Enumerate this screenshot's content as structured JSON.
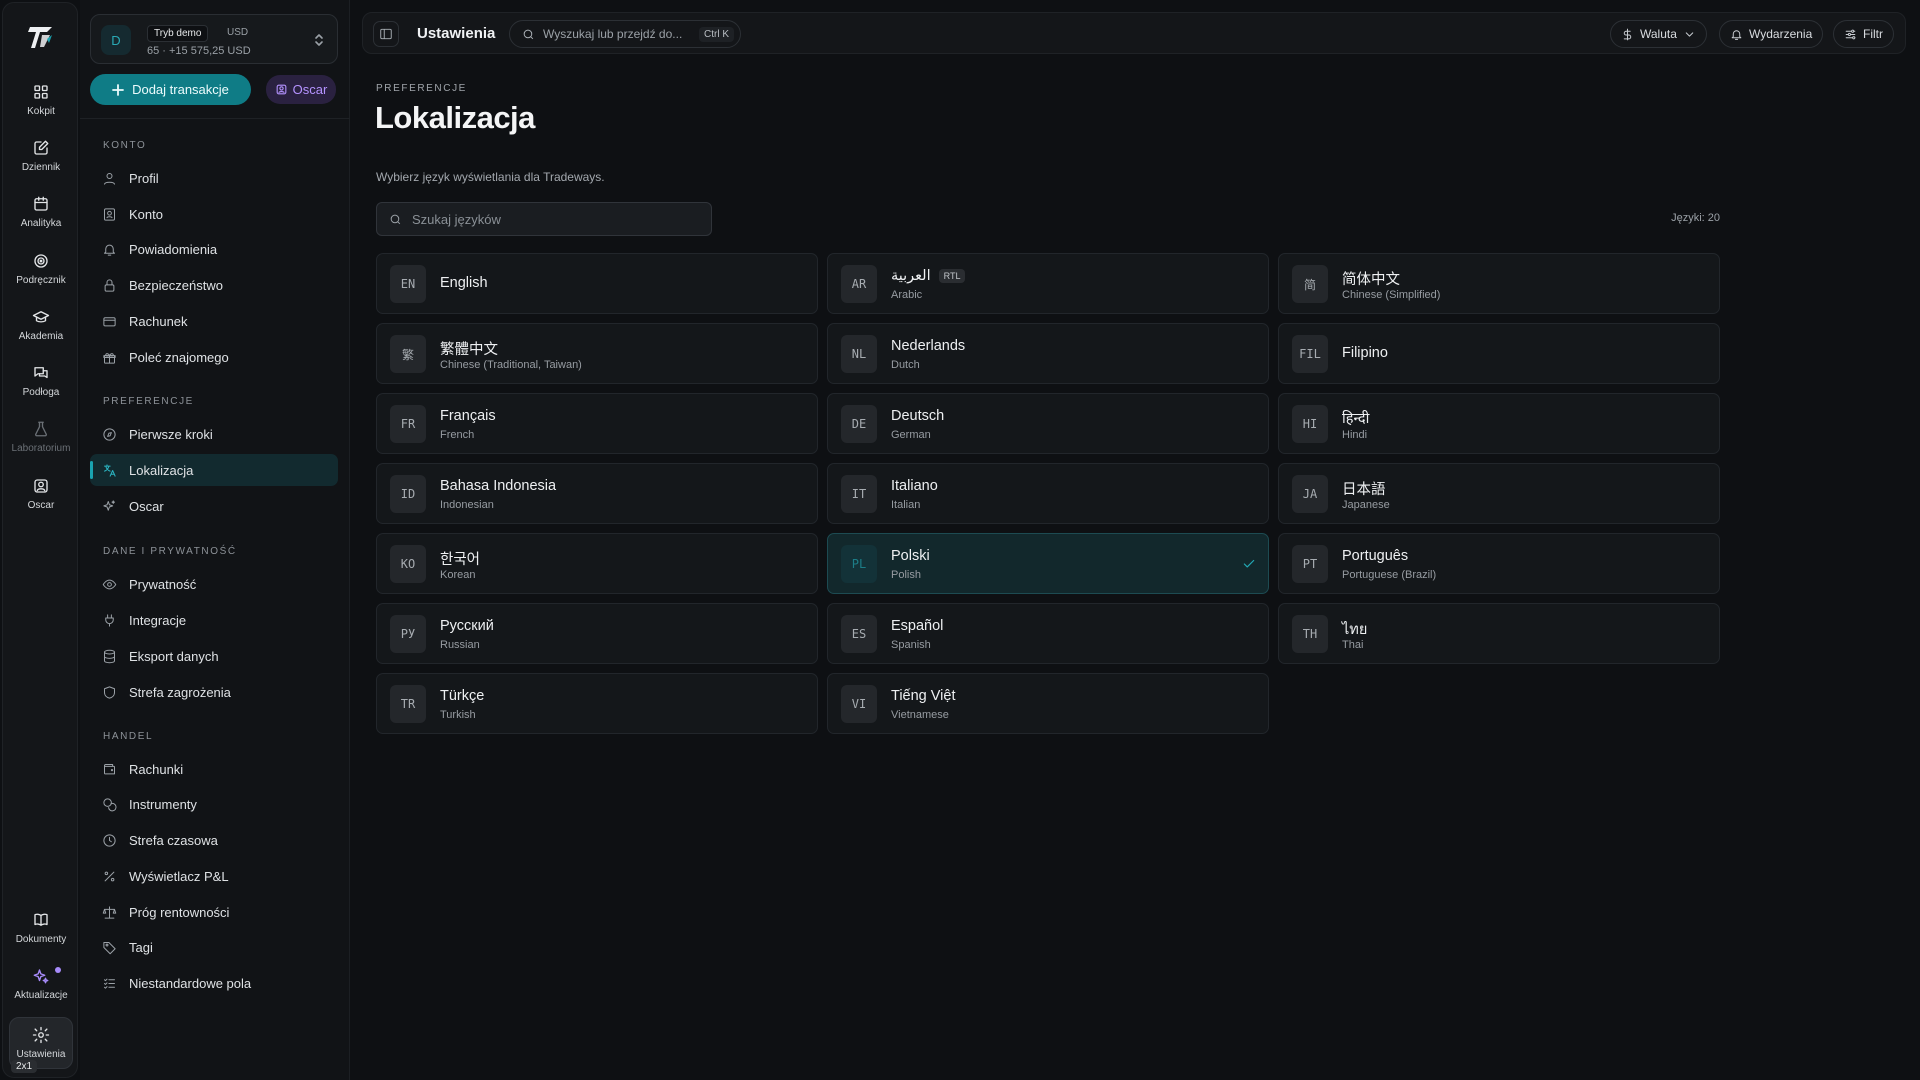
{
  "rail": {
    "items": [
      {
        "label": "Kokpit",
        "icon": "dashboard-icon"
      },
      {
        "label": "Dziennik",
        "icon": "journal-icon"
      },
      {
        "label": "Analityka",
        "icon": "calendar-icon"
      },
      {
        "label": "Podręcznik",
        "icon": "target-icon"
      },
      {
        "label": "Akademia",
        "icon": "graduation-cap-icon"
      },
      {
        "label": "Podłoga",
        "icon": "chat-icon"
      },
      {
        "label": "Laboratorium",
        "icon": "flask-icon"
      },
      {
        "label": "Oscar",
        "icon": "bot-icon"
      }
    ],
    "bottom": [
      {
        "label": "Dokumenty",
        "icon": "book-icon"
      },
      {
        "label": "Aktualizacje",
        "icon": "sparkle-icon"
      },
      {
        "label": "Ustawienia",
        "icon": "gear-icon"
      }
    ],
    "badge": "2x1"
  },
  "account": {
    "avatar": "D",
    "mode": "Tryb demo",
    "currency": "USD",
    "balance": "65 · +15 575,25 USD"
  },
  "actions": {
    "add_transaction": "Dodaj transakcje",
    "oscar": "Oscar"
  },
  "sidebar": {
    "sections": [
      {
        "title": "KONTO",
        "items": [
          "Profil",
          "Konto",
          "Powiadomienia",
          "Bezpieczeństwo",
          "Rachunek",
          "Poleć znajomego"
        ]
      },
      {
        "title": "PREFERENCJE",
        "items": [
          "Pierwsze kroki",
          "Lokalizacja",
          "Oscar"
        ]
      },
      {
        "title": "DANE I PRYWATNOŚĆ",
        "items": [
          "Prywatność",
          "Integracje",
          "Eksport danych",
          "Strefa zagrożenia"
        ]
      },
      {
        "title": "HANDEL",
        "items": [
          "Rachunki",
          "Instrumenty",
          "Strefa czasowa",
          "Wyświetlacz P&L",
          "Próg rentowności",
          "Tagi",
          "Niestandardowe pola"
        ]
      }
    ],
    "active": "Lokalizacja"
  },
  "topbar": {
    "title": "Ustawienia",
    "search_placeholder": "Wyszukaj lub przejdź do...",
    "shortcut": "Ctrl K",
    "currency_btn": "Waluta",
    "events_btn": "Wydarzenia",
    "filter_btn": "Filtr"
  },
  "page": {
    "eyebrow": "PREFERENCJE",
    "title": "Lokalizacja",
    "description": "Wybierz język wyświetlania dla Tradeways.",
    "search_placeholder": "Szukaj języków",
    "count": "Języki: 20"
  },
  "languages": [
    {
      "code": "EN",
      "native": "English",
      "english": "",
      "selected": false
    },
    {
      "code": "AR",
      "native": "العربية",
      "english": "Arabic",
      "rtl": "RTL",
      "selected": false
    },
    {
      "code": "简",
      "native": "简体中文",
      "english": "Chinese (Simplified)",
      "selected": false
    },
    {
      "code": "繁",
      "native": "繁體中文",
      "english": "Chinese (Traditional, Taiwan)",
      "selected": false
    },
    {
      "code": "NL",
      "native": "Nederlands",
      "english": "Dutch",
      "selected": false
    },
    {
      "code": "FIL",
      "native": "Filipino",
      "english": "",
      "selected": false
    },
    {
      "code": "FR",
      "native": "Français",
      "english": "French",
      "selected": false
    },
    {
      "code": "DE",
      "native": "Deutsch",
      "english": "German",
      "selected": false
    },
    {
      "code": "HI",
      "native": "हिन्दी",
      "english": "Hindi",
      "selected": false
    },
    {
      "code": "ID",
      "native": "Bahasa Indonesia",
      "english": "Indonesian",
      "selected": false
    },
    {
      "code": "IT",
      "native": "Italiano",
      "english": "Italian",
      "selected": false
    },
    {
      "code": "JA",
      "native": "日本語",
      "english": "Japanese",
      "selected": false
    },
    {
      "code": "KO",
      "native": "한국어",
      "english": "Korean",
      "selected": false
    },
    {
      "code": "PL",
      "native": "Polski",
      "english": "Polish",
      "selected": true
    },
    {
      "code": "PT",
      "native": "Português",
      "english": "Portuguese (Brazil)",
      "selected": false
    },
    {
      "code": "РУ",
      "native": "Русский",
      "english": "Russian",
      "selected": false
    },
    {
      "code": "ES",
      "native": "Español",
      "english": "Spanish",
      "selected": false
    },
    {
      "code": "TH",
      "native": "ไทย",
      "english": "Thai",
      "selected": false
    },
    {
      "code": "TR",
      "native": "Türkçe",
      "english": "Turkish",
      "selected": false
    },
    {
      "code": "VI",
      "native": "Tiếng Việt",
      "english": "Vietnamese",
      "selected": false
    }
  ],
  "colors": {
    "accent": "#0f7c86",
    "accent_text": "#22a9b5",
    "oscar": "#b593ff",
    "background": "#0e1013"
  }
}
